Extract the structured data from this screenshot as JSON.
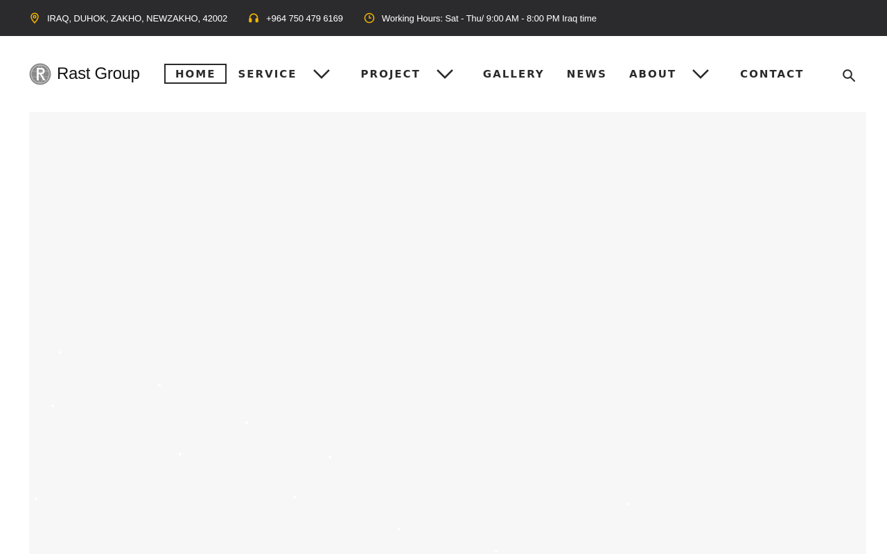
{
  "topbar": {
    "address": "IRAQ, DUHOK, ZAKHO, NEWZAKHO, 42002",
    "phone": "+964 750 479 6169",
    "hours": "Working Hours: Sat - Thu/ 9:00 AM - 8:00 PM Iraq time",
    "icons": [
      "location-pin-icon",
      "headset-icon",
      "clock-icon"
    ],
    "icon_color": "#f5b400",
    "background": "#2b2b2d"
  },
  "logo": {
    "text": "Rast Group",
    "icon": "globe-r-logo-icon"
  },
  "nav": {
    "items": [
      {
        "label": "HOME",
        "active": true,
        "dropdown": false
      },
      {
        "label": "SERVICE",
        "active": false,
        "dropdown": true
      },
      {
        "label": "PROJECT",
        "active": false,
        "dropdown": true
      },
      {
        "label": "GALLERY",
        "active": false,
        "dropdown": false
      },
      {
        "label": "NEWS",
        "active": false,
        "dropdown": false
      },
      {
        "label": "ABOUT",
        "active": false,
        "dropdown": true
      },
      {
        "label": "CONTACT",
        "active": false,
        "dropdown": false
      }
    ],
    "search_icon": "search-icon",
    "text_color": "#2a2a2a"
  },
  "hero": {
    "background": "#f7f7f7"
  }
}
